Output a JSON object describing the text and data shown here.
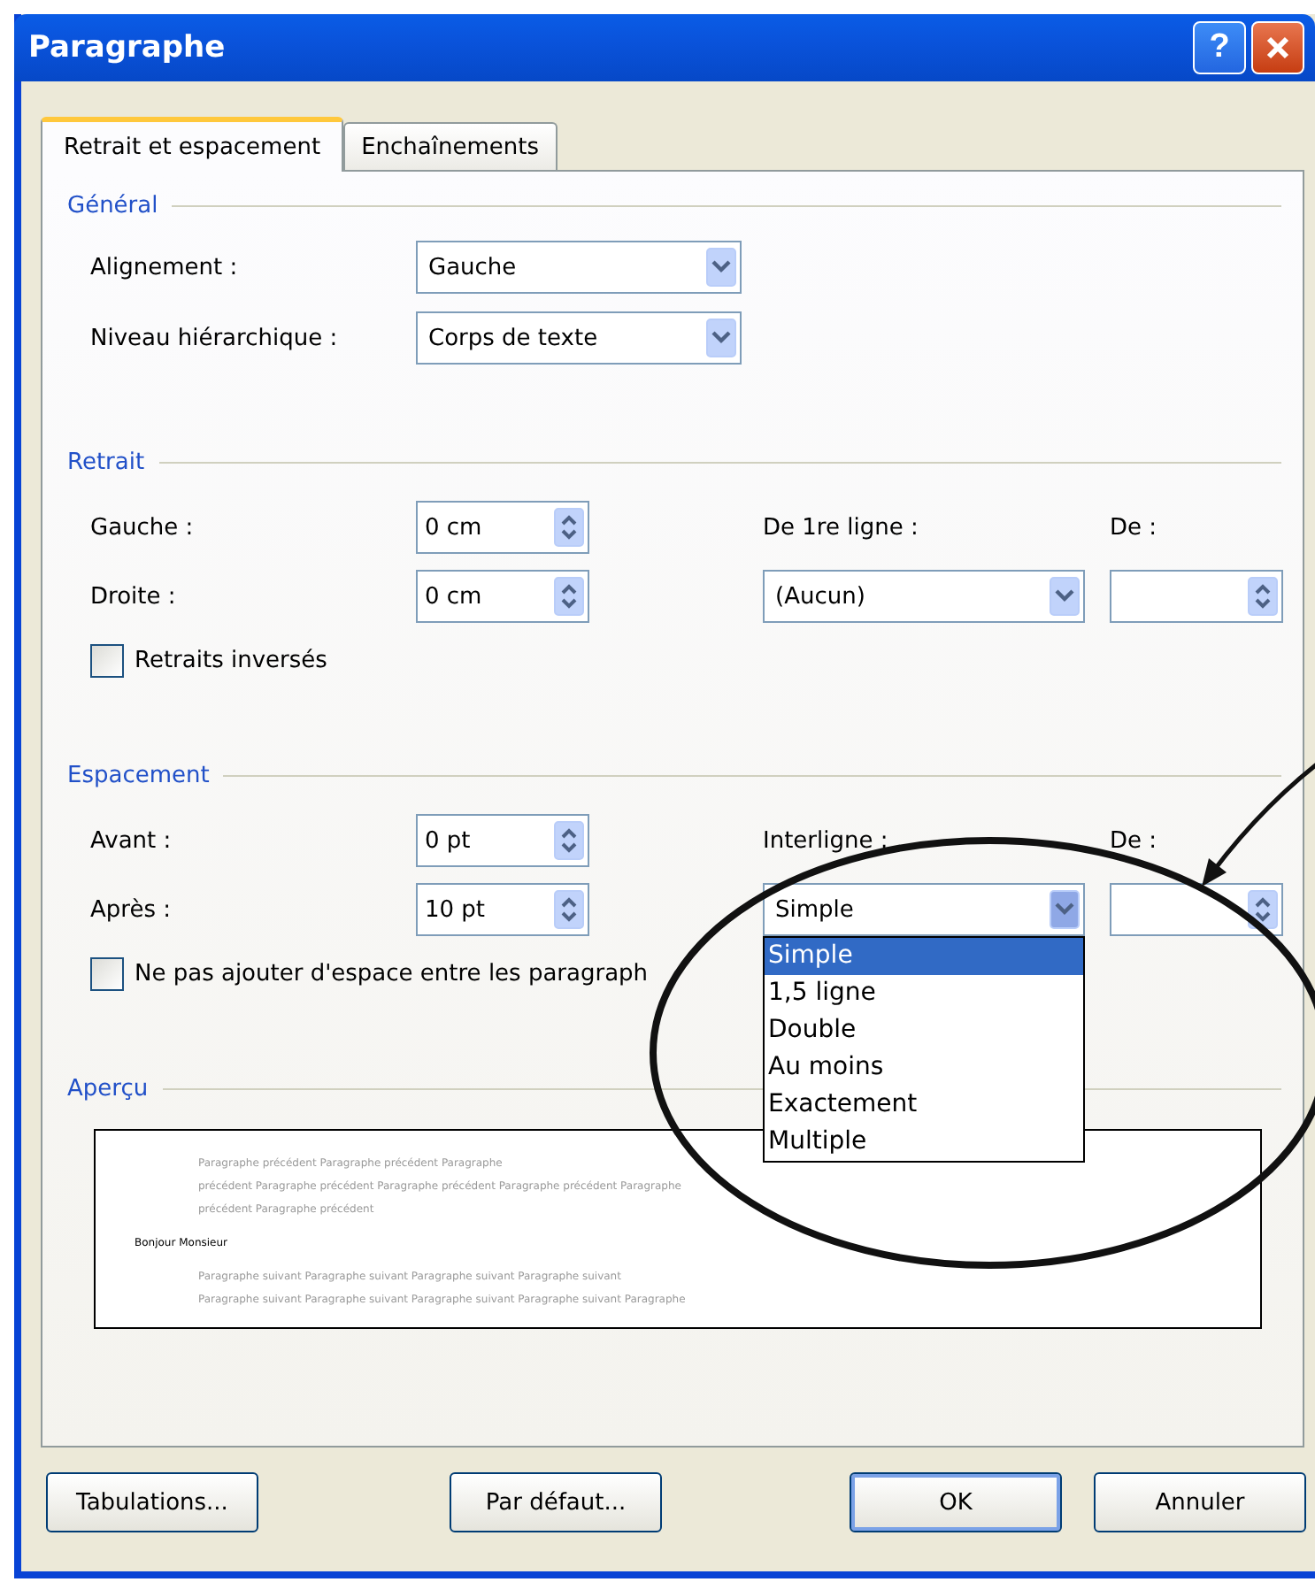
{
  "window": {
    "title": "Paragraphe",
    "help_button": "?"
  },
  "tabs": [
    {
      "label": "Retrait et espacement",
      "selected": true
    },
    {
      "label": "Enchaînements",
      "selected": false
    }
  ],
  "general": {
    "title": "Général",
    "fields": [
      {
        "label": "Alignement :",
        "value": "Gauche"
      },
      {
        "label": "Niveau hiérarchique :",
        "value": "Corps de texte"
      }
    ]
  },
  "sections": [
    {
      "title": "Retrait",
      "rows": [
        {
          "label": "Gauche :",
          "value": "0 cm"
        },
        {
          "label": "Droite :",
          "value": "0 cm"
        }
      ],
      "side_label": "De 1re ligne :",
      "by_label": "De :",
      "side_combo": {
        "value": "(Aucun)",
        "expanded": false
      },
      "checkbox": {
        "label": "Retraits inversés",
        "checked": false
      }
    },
    {
      "title": "Espacement",
      "rows": [
        {
          "label": "Avant :",
          "value": "0 pt"
        },
        {
          "label": "Après :",
          "value": "10 pt"
        }
      ],
      "side_label": "Interligne :",
      "by_label": "De :",
      "side_combo": {
        "value": "Simple",
        "expanded": true,
        "options": [
          {
            "label": "Simple",
            "selected": true
          },
          {
            "label": "1,5 ligne",
            "selected": false
          },
          {
            "label": "Double",
            "selected": false
          },
          {
            "label": "Au moins",
            "selected": false
          },
          {
            "label": "Exactement",
            "selected": false
          },
          {
            "label": "Multiple",
            "selected": false
          }
        ]
      },
      "checkbox": {
        "label": "Ne pas ajouter d'espace entre les paragraph",
        "checked": false
      }
    }
  ],
  "preview": {
    "title": "Aperçu",
    "lines": [
      {
        "kind": "previous",
        "text": "Paragraphe précédent Paragraphe précédent Paragraphe"
      },
      {
        "kind": "previous",
        "text": "précédent Paragraphe précédent Paragraphe précédent Paragraphe précédent Paragraphe"
      },
      {
        "kind": "previous",
        "text": "précédent Paragraphe précédent"
      },
      {
        "kind": "current",
        "text": "Bonjour Monsieur"
      },
      {
        "kind": "next",
        "text": "Paragraphe suivant Paragraphe suivant Paragraphe suivant Paragraphe suivant"
      },
      {
        "kind": "next",
        "text": "Paragraphe suivant Paragraphe suivant Paragraphe suivant Paragraphe suivant Paragraphe"
      }
    ]
  },
  "buttons": [
    {
      "label": "Tabulations...",
      "default": false
    },
    {
      "label": "Par défaut...",
      "default": false
    },
    {
      "label": "OK",
      "default": true
    },
    {
      "label": "Annuler",
      "default": false
    }
  ]
}
